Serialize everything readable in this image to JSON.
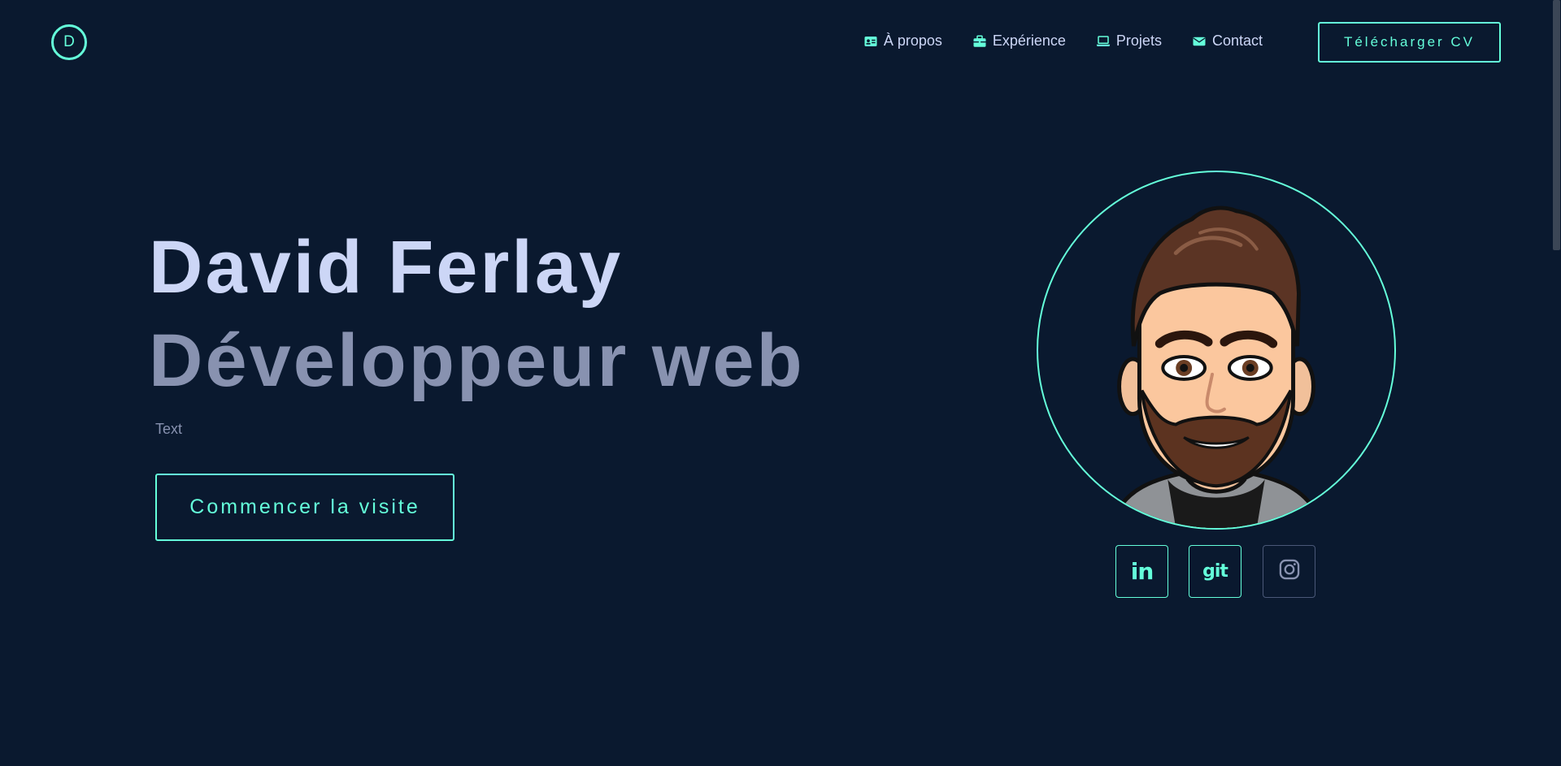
{
  "header": {
    "logo_letter": "D",
    "nav": [
      {
        "label": "À propos",
        "icon": "id-card-icon"
      },
      {
        "label": "Expérience",
        "icon": "briefcase-icon"
      },
      {
        "label": "Projets",
        "icon": "laptop-icon"
      },
      {
        "label": "Contact",
        "icon": "envelope-icon"
      }
    ],
    "cv_button": "Télécharger CV"
  },
  "hero": {
    "name": "David Ferlay",
    "role": "Développeur web",
    "text": "Text",
    "cta": "Commencer la visite"
  },
  "socials": [
    {
      "label": "in",
      "icon": "linkedin-icon"
    },
    {
      "label": "git",
      "icon": "git-icon"
    },
    {
      "label": "",
      "icon": "instagram-icon"
    }
  ],
  "colors": {
    "background": "#0a192f",
    "accent": "#64ffda",
    "heading": "#ccd6f6",
    "muted": "#8892b0"
  }
}
